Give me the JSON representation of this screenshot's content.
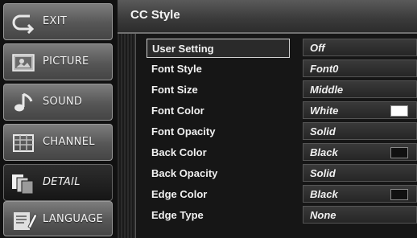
{
  "sidebar": {
    "items": [
      {
        "label": "EXIT",
        "icon": "exit-icon"
      },
      {
        "label": "PICTURE",
        "icon": "picture-icon"
      },
      {
        "label": "SOUND",
        "icon": "sound-icon"
      },
      {
        "label": "CHANNEL",
        "icon": "channel-icon"
      },
      {
        "label": "DETAIL",
        "icon": "detail-icon",
        "active": true
      },
      {
        "label": "LANGUAGE",
        "icon": "language-icon"
      }
    ]
  },
  "main": {
    "title": "CC Style",
    "settings": [
      {
        "label": "User Setting",
        "value": "Off",
        "selected": true
      },
      {
        "label": "Font Style",
        "value": "Font0"
      },
      {
        "label": "Font Size",
        "value": "Middle"
      },
      {
        "label": "Font Color",
        "value": "White",
        "swatch": "#ffffff"
      },
      {
        "label": "Font Opacity",
        "value": "Solid"
      },
      {
        "label": "Back Color",
        "value": "Black",
        "swatch": "#111111"
      },
      {
        "label": "Back Opacity",
        "value": "Solid"
      },
      {
        "label": "Edge Color",
        "value": "Black",
        "swatch": "#111111"
      },
      {
        "label": "Edge Type",
        "value": "None"
      }
    ]
  }
}
